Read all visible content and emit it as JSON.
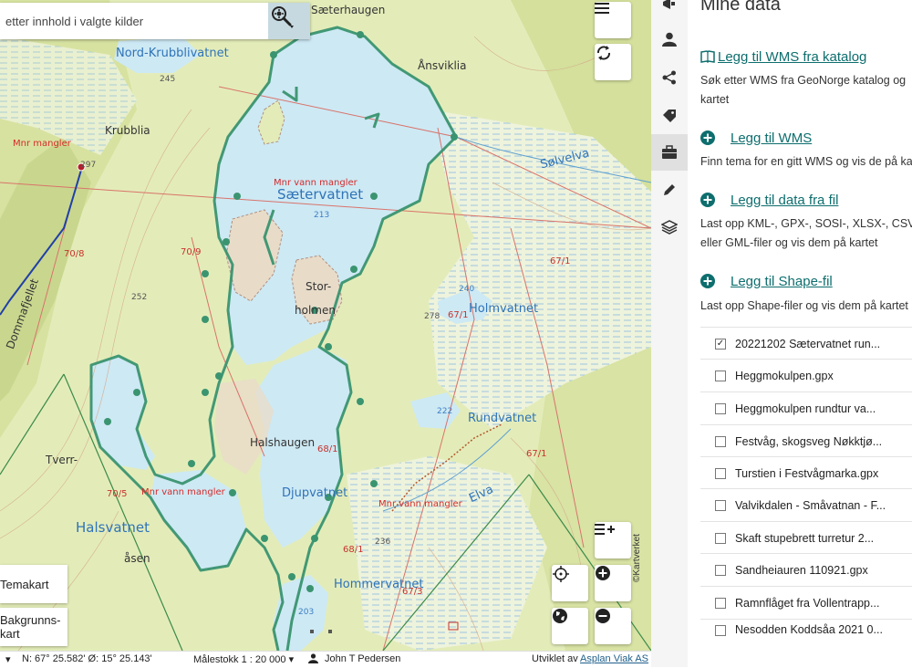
{
  "search": {
    "placeholder": "etter innhold i valgte kilder"
  },
  "map": {
    "labels": {
      "saeterhaugen": "Sæterhaugen",
      "nord_krubblivatnet": "Nord-Krubblivatnet",
      "aansviklia": "Ånsviklia",
      "krubblia": "Krubblia",
      "mnr_mangler_1": "Mnr mangler",
      "mnr_vann_mangler_1": "Mnr vann mangler",
      "saetervatnet": "Sætervatnet",
      "solvelva": "Sølvelva",
      "stor_holmen_1": "Stor-",
      "stor_holmen_2": "holmen",
      "holmvatnet": "Holmvatnet",
      "rundvatnet": "Rundvatnet",
      "halshaugen": "Halshaugen",
      "djupvatnet": "Djupvatnet",
      "tverr": "Tverr-",
      "halsvatnet": "Halsvatnet",
      "aasen": "åsen",
      "mnr_vann_mangler_2": "Mnr vann mangler",
      "mnr_vann_mangler_3": "Mnr vann mangler",
      "dommafjellet": "Dommafjellet",
      "hommervatnet": "Hommervatnet",
      "elva": "Elva",
      "n245": "245",
      "n297": "297",
      "n213": "213",
      "n252": "252",
      "n278": "278",
      "n240": "240",
      "n222": "222",
      "n236": "236",
      "n203": "203",
      "r70_8": "70/8",
      "r70_9": "70/9",
      "r67_1a": "67/1",
      "r67_1b": "67/1",
      "r67_1c": "67/1",
      "r68_1a": "68/1",
      "r68_1b": "68/1",
      "r70_5": "70/5",
      "r67_3": "67/3"
    },
    "layer_buttons": {
      "temakart": "Temakart",
      "bakgrunnskart_1": "Bakgrunns-",
      "bakgrunnskart_2": "kart"
    },
    "attribution": "©Kartverket"
  },
  "statusbar": {
    "coords": "N: 67° 25.582' Ø: 15° 25.143'",
    "scale": "Målestokk 1 : 20 000",
    "user": "John T Pedersen",
    "dev_prefix": "Utviklet av",
    "dev_link": "Asplan Viak AS"
  },
  "panel": {
    "title": "Mine data",
    "actions": [
      {
        "label": "Legg til WMS fra katalog",
        "desc1": "Søk etter WMS fra GeoNorge katalog og",
        "desc2": "kartet",
        "icon": "book-icon"
      },
      {
        "label": "Legg til WMS",
        "desc1": "Finn tema for en gitt WMS og vis de på ka",
        "icon": "plus-circle-icon"
      },
      {
        "label": "Legg til data fra fil",
        "desc1": "Last opp KML-, GPX-, SOSI-, XLSX-, CSV-, G",
        "desc2": "eller GML-filer og vis dem på kartet",
        "icon": "plus-circle-icon"
      },
      {
        "label": "Legg til Shape-fil",
        "desc1": "Last opp Shape-filer og vis dem på kartet",
        "icon": "plus-circle-icon"
      }
    ],
    "files": [
      {
        "name": "20221202 Sætervatnet run...",
        "checked": true
      },
      {
        "name": "Heggmokulpen.gpx",
        "checked": false
      },
      {
        "name": "Heggmokulpen rundtur va...",
        "checked": false
      },
      {
        "name": "Festvåg, skogsveg Nøkktjø...",
        "checked": false
      },
      {
        "name": "Turstien i Festvågmarka.gpx",
        "checked": false
      },
      {
        "name": "Valvikdalen - Småvatnan - F...",
        "checked": false
      },
      {
        "name": "Skaft stupebrett turretur 2...",
        "checked": false
      },
      {
        "name": "Sandheiauren 110921.gpx",
        "checked": false
      },
      {
        "name": "Ramnflåget fra Vollentrapp...",
        "checked": false
      },
      {
        "name": "Nesodden Koddsåa 2021 0...",
        "checked": false
      }
    ]
  },
  "colors": {
    "accent": "#0e6e6e",
    "track": "#3a9470",
    "water": "#cde9f4",
    "land": "#e9efc5"
  }
}
